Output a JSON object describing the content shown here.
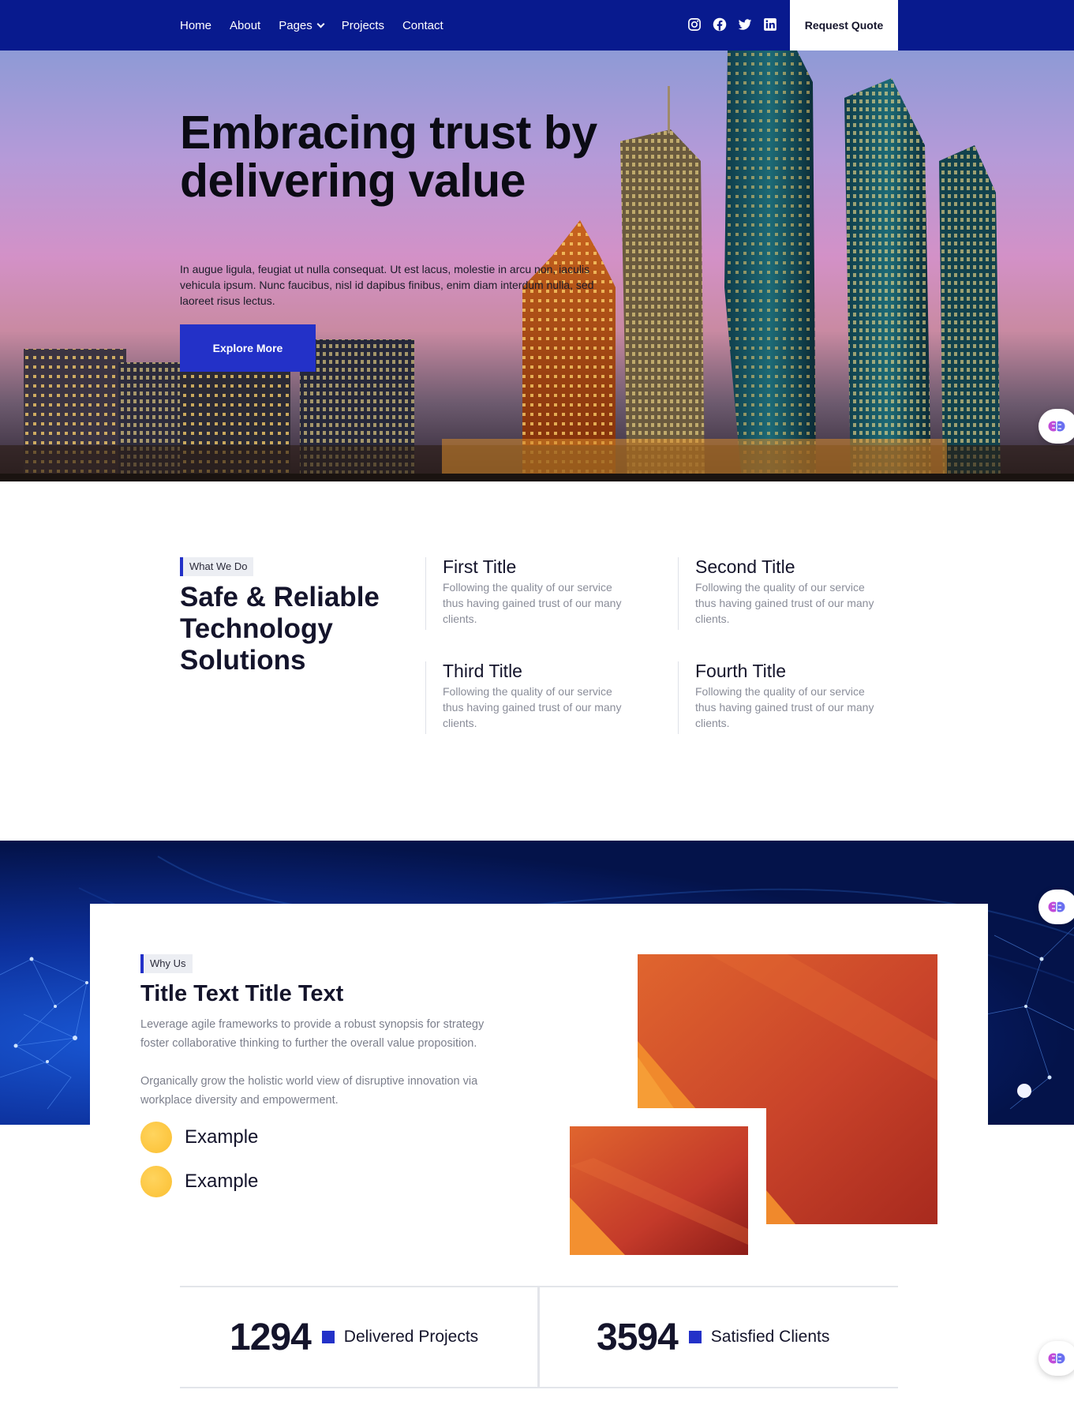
{
  "nav": {
    "links": [
      {
        "label": "Home"
      },
      {
        "label": "About"
      },
      {
        "label": "Pages"
      },
      {
        "label": "Projects"
      },
      {
        "label": "Contact"
      }
    ],
    "social_icons": [
      "instagram-icon",
      "facebook-icon",
      "twitter-icon",
      "linkedin-icon"
    ],
    "cta_label": "Request Quote"
  },
  "hero": {
    "title": "Embracing trust by delivering value",
    "text": "In augue ligula, feugiat ut nulla consequat. Ut est lacus, molestie in arcu non, iaculis vehicula ipsum. Nunc faucibus, nisl id dapibus finibus, enim diam interdum nulla, sed laoreet risus lectus.",
    "button_label": "Explore More"
  },
  "what_we_do": {
    "tag": "What We Do",
    "title": "Safe & Reliable Technology Solutions",
    "features": [
      {
        "title": "First Title",
        "text": "Following the quality of our service thus having gained trust of our many clients."
      },
      {
        "title": "Second Title",
        "text": "Following the quality of our service thus having gained trust of our many clients."
      },
      {
        "title": "Third Title",
        "text": "Following the quality of our service thus having gained trust of our many clients."
      },
      {
        "title": "Fourth Title",
        "text": "Following the quality of our service thus having gained trust of our many clients."
      }
    ]
  },
  "why_us": {
    "tag": "Why Us",
    "title": "Title Text Title Text",
    "paragraph_1": "Leverage agile frameworks to provide a robust synopsis for strategy foster collaborative thinking to further the overall value proposition.",
    "paragraph_2": "Organically grow the holistic world view of disruptive innovation via workplace diversity and empowerment.",
    "items": [
      {
        "label": "Example"
      },
      {
        "label": "Example"
      }
    ]
  },
  "stats": [
    {
      "number": "1294",
      "label": "Delivered Projects"
    },
    {
      "number": "3594",
      "label": "Satisfied Clients"
    }
  ],
  "colors": {
    "nav_bg": "#081a8e",
    "accent": "#2331c8",
    "dot": "#fbbf31",
    "orange": "#e0532a"
  }
}
